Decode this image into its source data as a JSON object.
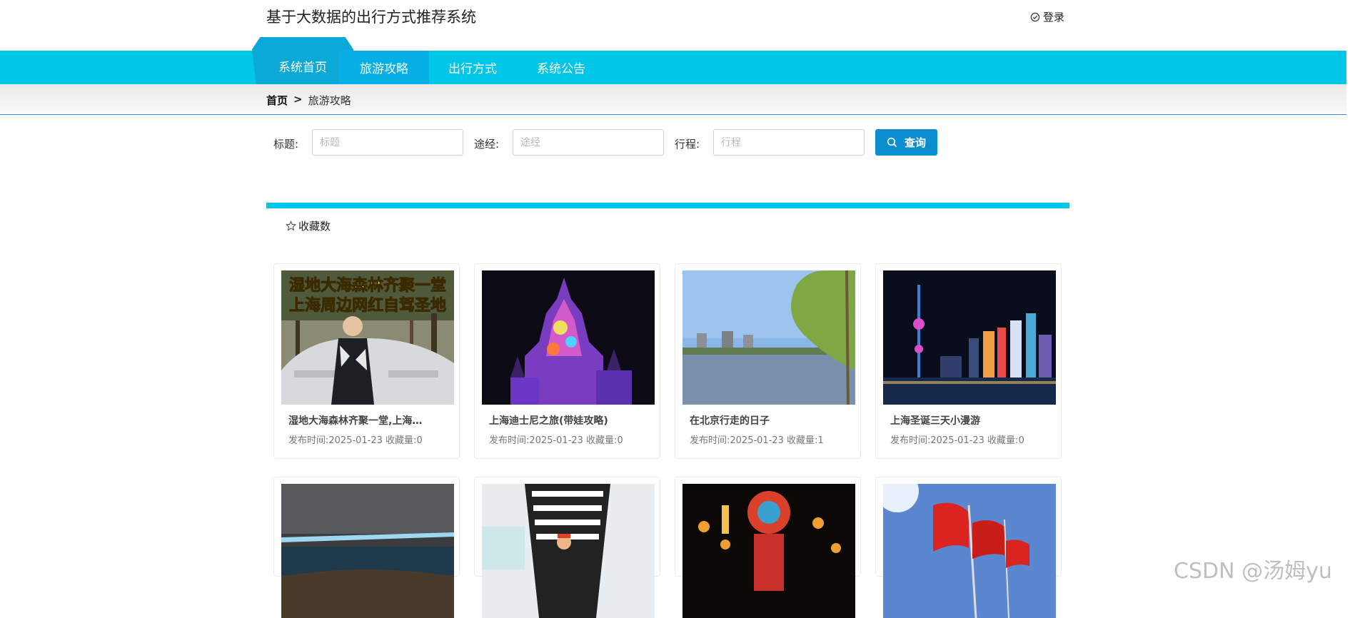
{
  "header": {
    "site_title": "基于大数据的出行方式推荐系统",
    "login_label": "登录",
    "login_icon": "check-circle-icon"
  },
  "nav": {
    "items": [
      {
        "label": "系统首页"
      },
      {
        "label": "旅游攻略"
      },
      {
        "label": "出行方式"
      },
      {
        "label": "系统公告"
      }
    ],
    "active_index": 1
  },
  "breadcrumb": {
    "home": "首页",
    "separator": ">",
    "current": "旅游攻略"
  },
  "search": {
    "fields": [
      {
        "label": "标题:",
        "placeholder": "标题",
        "value": ""
      },
      {
        "label": "途经:",
        "placeholder": "途经",
        "value": ""
      },
      {
        "label": "行程:",
        "placeholder": "行程",
        "value": ""
      }
    ],
    "button_label": "查询",
    "button_icon": "search-icon"
  },
  "sort": {
    "label": "收藏数",
    "icon": "star-outline-icon"
  },
  "cards": [
    {
      "title": "湿地大海森林齐聚一堂,上海…",
      "meta": "发布时间:2025-01-23 收藏量:0",
      "image_caption_1": "湿地大海森林齐聚一堂",
      "image_caption_2": "上海周边网红自驾圣地"
    },
    {
      "title": "上海迪士尼之旅(带娃攻略)",
      "meta": "发布时间:2025-01-23 收藏量:0"
    },
    {
      "title": "在北京行走的日子",
      "meta": "发布时间:2025-01-23 收藏量:1"
    },
    {
      "title": "上海圣诞三天小漫游",
      "meta": "发布时间:2025-01-23 收藏量:0"
    },
    {
      "title": "",
      "meta": ""
    },
    {
      "title": "",
      "meta": ""
    },
    {
      "title": "",
      "meta": ""
    },
    {
      "title": "",
      "meta": ""
    }
  ],
  "watermark": "CSDN @汤姆yu",
  "colors": {
    "nav_bg": "#00c7e8",
    "nav_active": "#06b0e6",
    "home_tab": "#0aa9d8",
    "button_bg": "#0a8ed0",
    "divider": "#00c7e8"
  }
}
